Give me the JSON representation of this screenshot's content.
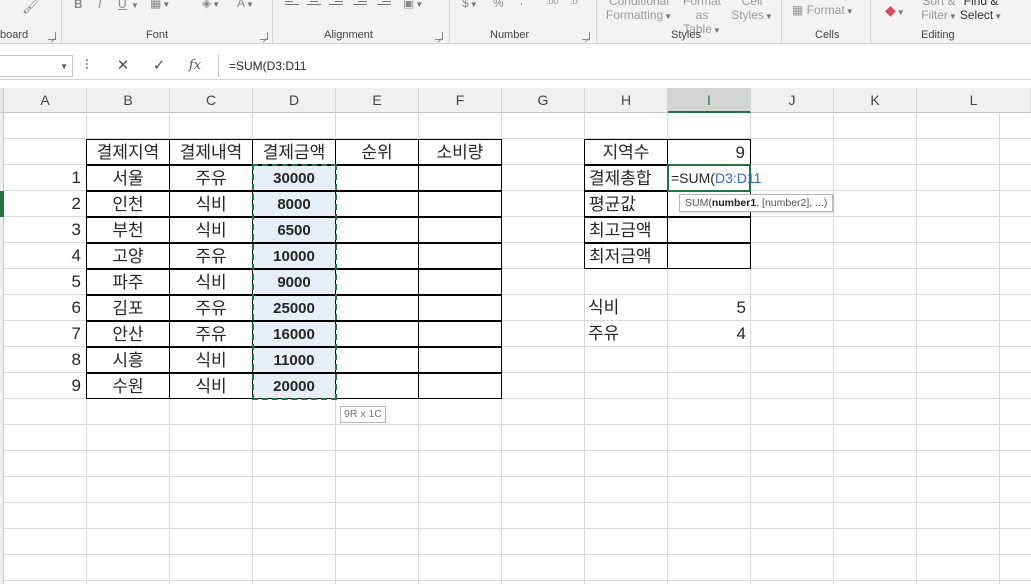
{
  "ribbon": {
    "groups": [
      {
        "label": "board",
        "has_launcher": true
      },
      {
        "label": "Font",
        "has_launcher": true
      },
      {
        "label": "Alignment",
        "has_launcher": true
      },
      {
        "label": "Number",
        "has_launcher": true
      },
      {
        "label": "Styles",
        "has_launcher": false
      },
      {
        "label": "Cells",
        "has_launcher": false
      },
      {
        "label": "Editing",
        "has_launcher": false
      }
    ],
    "font_buttons": {
      "bold": "B",
      "italic": "I",
      "underline": "U"
    },
    "number_buttons": {
      "currency": "$",
      "percent": "%"
    },
    "styles": {
      "conditional_formatting": "Conditional Formatting",
      "format_as_table": "Format as Table",
      "cell_styles": "Cell Styles"
    },
    "cells": {
      "format": "Format"
    },
    "editing": {
      "sort_filter": "Sort & Filter",
      "find_select": "Find & Select"
    }
  },
  "formula_bar": {
    "name_box": "",
    "formula": "=SUM(D3:D11"
  },
  "columns": [
    "A",
    "B",
    "C",
    "D",
    "E",
    "F",
    "G",
    "H",
    "I",
    "J",
    "K",
    "L"
  ],
  "active_column": "I",
  "main_table": {
    "headers": [
      "결제지역",
      "결제내역",
      "결제금액",
      "순위",
      "소비량"
    ],
    "rows": [
      {
        "no": "1",
        "region": "서울",
        "type": "주유",
        "amount": "30000"
      },
      {
        "no": "2",
        "region": "인천",
        "type": "식비",
        "amount": "8000"
      },
      {
        "no": "3",
        "region": "부천",
        "type": "식비",
        "amount": "6500"
      },
      {
        "no": "4",
        "region": "고양",
        "type": "주유",
        "amount": "10000"
      },
      {
        "no": "5",
        "region": "파주",
        "type": "식비",
        "amount": "9000"
      },
      {
        "no": "6",
        "region": "김포",
        "type": "주유",
        "amount": "25000"
      },
      {
        "no": "7",
        "region": "안산",
        "type": "주유",
        "amount": "16000"
      },
      {
        "no": "8",
        "region": "시흥",
        "type": "식비",
        "amount": "11000"
      },
      {
        "no": "9",
        "region": "수원",
        "type": "식비",
        "amount": "20000"
      }
    ]
  },
  "summary_table": {
    "region_count_label": "지역수",
    "region_count_value": "9",
    "total_label": "결제총합",
    "average_label": "평균값",
    "max_label": "최고금액",
    "min_label": "최저금액"
  },
  "edit": {
    "formula_prefix": "=SUM(",
    "formula_ref": "D3:D11",
    "tooltip_func": "SUM(",
    "tooltip_arg1": "number1",
    "tooltip_rest": ", [number2], ...)",
    "size_indicator": "9R x 1C"
  },
  "category_counts": [
    {
      "label": "식비",
      "value": "5"
    },
    {
      "label": "주유",
      "value": "4"
    }
  ],
  "colors": {
    "accent": "#217346",
    "ref_blue": "#2e6bc4"
  }
}
